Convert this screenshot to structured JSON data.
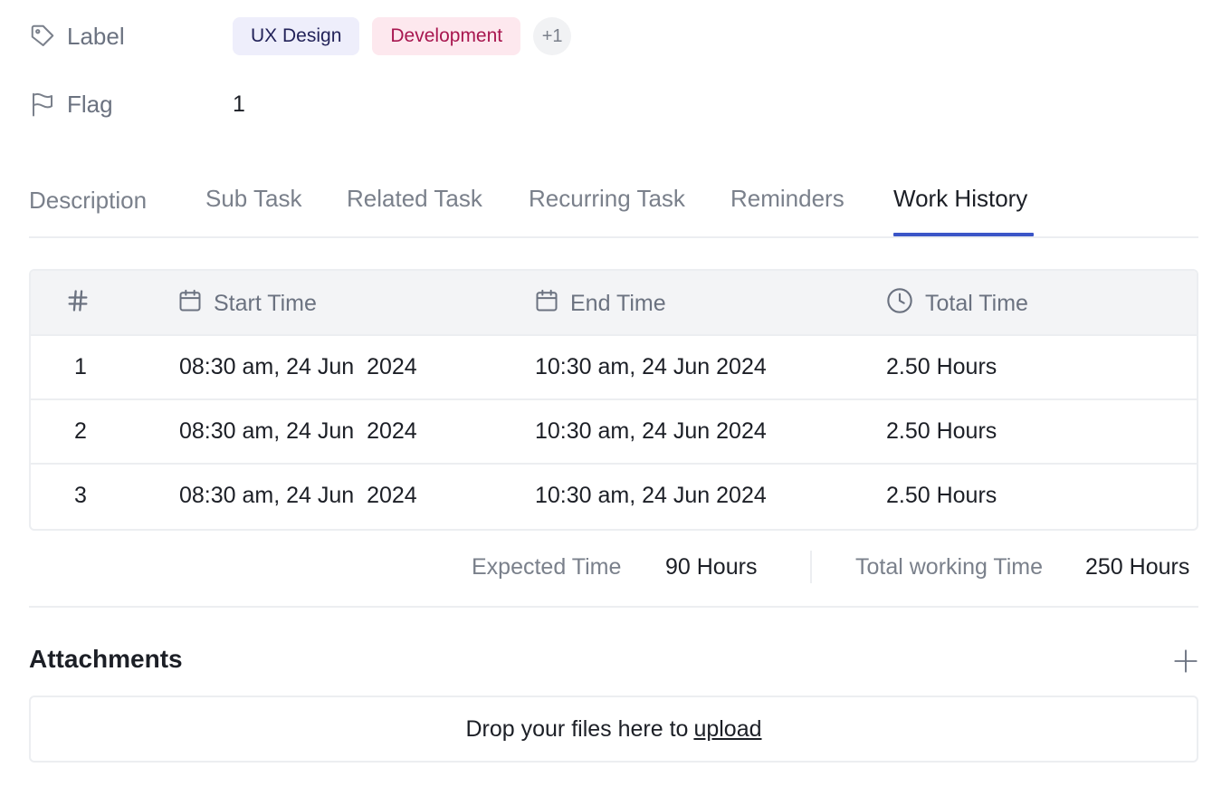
{
  "properties": {
    "label": {
      "name": "Label",
      "tags": [
        {
          "text": "UX Design"
        },
        {
          "text": "Development"
        }
      ],
      "more": "+1"
    },
    "flag": {
      "name": "Flag",
      "value": "1"
    }
  },
  "tabs": [
    {
      "label": "Description"
    },
    {
      "label": "Sub Task"
    },
    {
      "label": "Related Task"
    },
    {
      "label": "Recurring Task"
    },
    {
      "label": "Reminders"
    },
    {
      "label": "Work History",
      "active": true
    }
  ],
  "table": {
    "headers": {
      "num_icon": "hash-icon",
      "start": "Start Time",
      "end": "End Time",
      "total": "Total Time"
    },
    "rows": [
      {
        "num": "1",
        "start": "08:30 am, 24 Jun  2024",
        "end": "10:30 am, 24 Jun 2024",
        "total": "2.50 Hours"
      },
      {
        "num": "2",
        "start": "08:30 am, 24 Jun  2024",
        "end": "10:30 am, 24 Jun 2024",
        "total": "2.50 Hours"
      },
      {
        "num": "3",
        "start": "08:30 am, 24 Jun  2024",
        "end": "10:30 am, 24 Jun 2024",
        "total": "2.50 Hours"
      }
    ]
  },
  "summary": {
    "expected_label": "Expected Time",
    "expected_value": "90 Hours",
    "working_label": "Total working Time",
    "working_value": "250 Hours"
  },
  "attachments": {
    "title": "Attachments",
    "drop_text": "Drop your files here to",
    "upload_link": "upload"
  },
  "colors": {
    "accent": "#3b55c7",
    "tag_ux_bg": "#eeeefb",
    "tag_dev_bg": "#fde8ee",
    "tag_dev_text": "#a8164f"
  }
}
